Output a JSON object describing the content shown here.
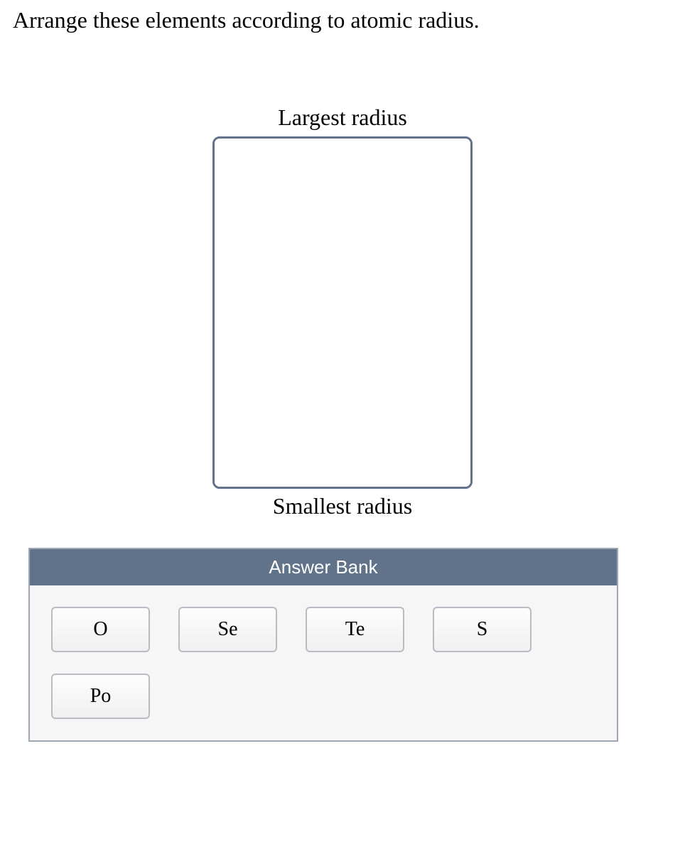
{
  "question": "Arrange these elements according to atomic radius.",
  "labels": {
    "top": "Largest radius",
    "bottom": "Smallest radius"
  },
  "answerBank": {
    "title": "Answer Bank",
    "items": [
      "O",
      "Se",
      "Te",
      "S",
      "Po"
    ]
  }
}
